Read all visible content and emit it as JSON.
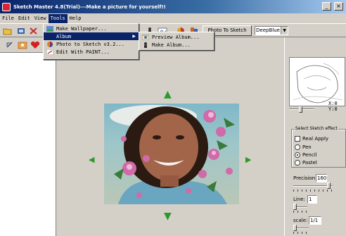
{
  "window": {
    "title": "Sketch Master 4.8(Trial)---Make a picture for yourself!!",
    "minimize": "_",
    "close": "×"
  },
  "menubar": {
    "items": [
      {
        "label": "File"
      },
      {
        "label": "Edit"
      },
      {
        "label": "View"
      },
      {
        "label": "Tools"
      },
      {
        "label": "Help"
      }
    ]
  },
  "tools_menu": {
    "items": [
      {
        "label": "Make Wallpaper...",
        "icon": "wallpaper-icon"
      },
      {
        "label": "Album",
        "icon": "album-icon",
        "has_submenu": true
      },
      {
        "label": "Photo to Sketch v3.2...",
        "icon": "photo-to-sketch-icon"
      },
      {
        "label": "Edit With PAINT...",
        "icon": "paint-icon"
      }
    ]
  },
  "album_submenu": {
    "items": [
      {
        "label": "Preview Album...",
        "icon": "preview-album-icon"
      },
      {
        "label": "Make Album...",
        "icon": "make-album-icon"
      }
    ]
  },
  "toolbar": {
    "photo_to_sketch_label": "Photo To Sketch",
    "style_combo_value": "DeepBlue"
  },
  "preview": {
    "x_label": "X:",
    "x_value": "0",
    "y_label": "Y:",
    "y_value": "0"
  },
  "sketch_effect": {
    "group_title": "Select Sketch effect",
    "real_apply_label": "Real Apply",
    "real_apply_checked": false,
    "options": [
      {
        "label": "Pen",
        "checked": false
      },
      {
        "label": "Pencil",
        "checked": true
      },
      {
        "label": "Pastel",
        "checked": false
      }
    ]
  },
  "params": {
    "precision_label": "Precision:",
    "precision_value": "160",
    "line_label": "Line:",
    "line_value": "1",
    "scale_label": "scale:",
    "scale_value": "1/1"
  },
  "colors": {
    "title_start": "#0a246a",
    "title_end": "#a6caf0",
    "menu_highlight": "#0a246a",
    "move_arrow": "#2a9a2a",
    "face": "#a2654a"
  }
}
